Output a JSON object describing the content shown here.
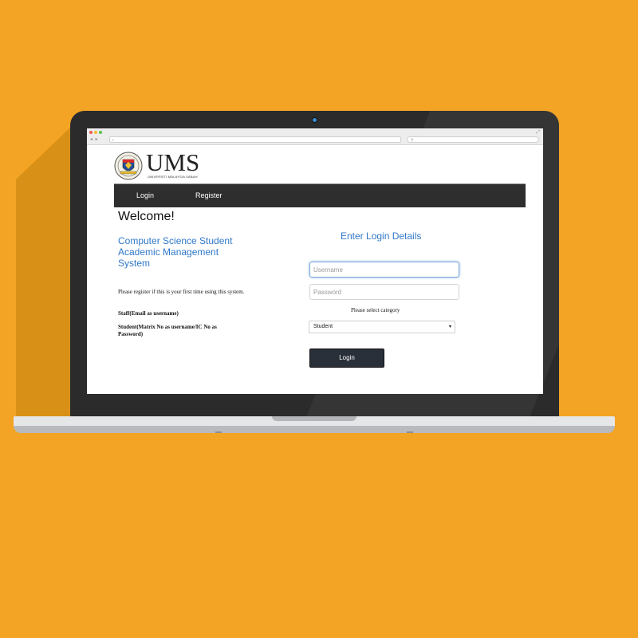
{
  "colors": {
    "background": "#F3A424",
    "navbar": "#2E2E2E",
    "accent_blue": "#2F78C9",
    "button": "#2A303A"
  },
  "browser": {
    "back_icon": "chevron-left-icon",
    "forward_icon": "chevron-right-icon",
    "url_glyph": "»",
    "search_glyph": "🔍"
  },
  "header": {
    "logo_text": "UMS",
    "logo_subtitle": "UNIVERSITI MALAYSIA SABAH"
  },
  "navbar": {
    "items": [
      {
        "label": "Login"
      },
      {
        "label": "Register"
      }
    ]
  },
  "main": {
    "welcome": "Welcome!",
    "system_name": "Computer Science Student Academic Management System",
    "register_note": "Please register if this is your first time using this system.",
    "staff_note": "Staff(Email as username)",
    "student_note": "Student(Matrix No as username/IC No as Password)"
  },
  "login_form": {
    "heading": "Enter Login Details",
    "username_placeholder": "Username",
    "password_placeholder": "Password",
    "category_label": "Please select category",
    "category_selected": "Student",
    "login_button": "Login"
  }
}
